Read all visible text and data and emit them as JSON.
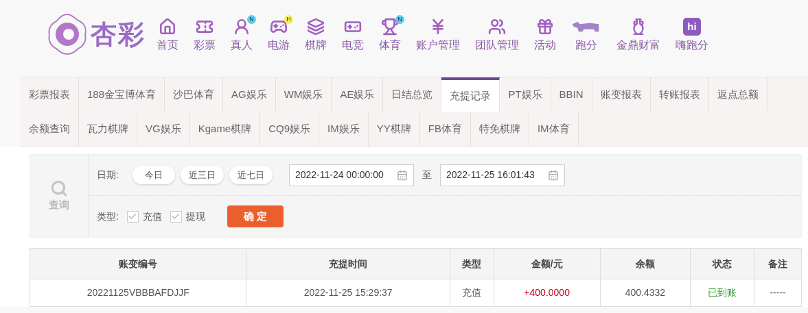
{
  "logo": {
    "text": "杏彩"
  },
  "nav": [
    {
      "label": "首页"
    },
    {
      "label": "彩票"
    },
    {
      "label": "真人",
      "badge": {
        "text": "N",
        "color": "#5ccdf2"
      }
    },
    {
      "label": "电游",
      "badge": {
        "text": "H",
        "color": "#f7ee57"
      }
    },
    {
      "label": "棋牌"
    },
    {
      "label": "电竞"
    },
    {
      "label": "体育",
      "badge": {
        "text": "N",
        "color": "#5ccdf2"
      }
    },
    {
      "label": "账户管理"
    },
    {
      "label": "团队管理"
    },
    {
      "label": "活动"
    },
    {
      "label": "跑分"
    },
    {
      "label": "金鼎财富"
    },
    {
      "label": "嗨跑分",
      "icon_text": "hi"
    }
  ],
  "tab_rows": [
    [
      {
        "label": "彩票报表",
        "selected": false
      },
      {
        "label": "188金宝博体育",
        "selected": false
      },
      {
        "label": "沙巴体育",
        "selected": false
      },
      {
        "label": "AG娱乐",
        "selected": false
      },
      {
        "label": "WM娱乐",
        "selected": false
      },
      {
        "label": "AE娱乐",
        "selected": false
      },
      {
        "label": "日结总览",
        "selected": false
      },
      {
        "label": "充提记录",
        "selected": true
      },
      {
        "label": "PT娱乐",
        "selected": false
      },
      {
        "label": "BBIN",
        "selected": false
      },
      {
        "label": "账变报表",
        "selected": false
      },
      {
        "label": "转账报表",
        "selected": false
      },
      {
        "label": "返点总额",
        "selected": false
      }
    ],
    [
      {
        "label": "余额查询",
        "selected": false
      },
      {
        "label": "瓦力棋牌",
        "selected": false
      },
      {
        "label": "VG娱乐",
        "selected": false
      },
      {
        "label": "Kgame棋牌",
        "selected": false
      },
      {
        "label": "CQ9娱乐",
        "selected": false
      },
      {
        "label": "IM娱乐",
        "selected": false
      },
      {
        "label": "YY棋牌",
        "selected": false
      },
      {
        "label": "FB体育",
        "selected": false
      },
      {
        "label": "特免棋牌",
        "selected": false
      },
      {
        "label": "IM体育",
        "selected": false
      }
    ]
  ],
  "filter": {
    "side_label": "查询",
    "date_label": "日期:",
    "quick_ranges": [
      "今日",
      "近三日",
      "近七日"
    ],
    "start": "2022-11-24 00:00:00",
    "separator": "至",
    "end": "2022-11-25 16:01:43",
    "type_label": "类型:",
    "types": [
      {
        "label": "充值",
        "checked": true
      },
      {
        "label": "提现",
        "checked": true
      }
    ],
    "submit": "确 定"
  },
  "table": {
    "columns": [
      "账变编号",
      "充提时间",
      "类型",
      "金额/元",
      "余额",
      "状态",
      "备注"
    ],
    "rows": [
      {
        "id": "20221125VBBBAFDJJF",
        "time": "2022-11-25 15:29:37",
        "type": "充值",
        "amount": "+400.0000",
        "balance": "400.4332",
        "status": "已到账",
        "note": "-----"
      }
    ]
  }
}
